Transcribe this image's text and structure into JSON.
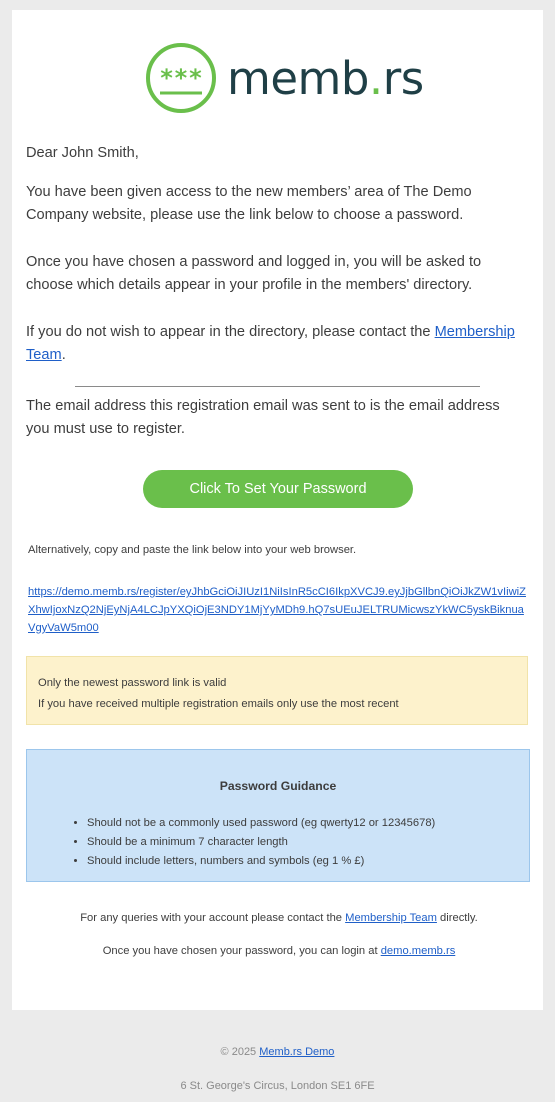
{
  "logo": {
    "brand_prefix": "memb",
    "brand_dot": ".",
    "brand_suffix": "rs",
    "mark_icon": "asterisk-badge-icon",
    "accent_color": "#6abf4b",
    "text_color": "#1f3f46"
  },
  "email": {
    "greeting": "Dear John Smith,",
    "para1": "You have been given access to the new members’ area of The Demo Company website, please use the link below to choose a password.",
    "para2": "Once you have chosen a password and logged in, you will be asked to choose which details appear in your profile in the members' directory.",
    "para3_prefix": "If you do not wish to appear in the directory, please contact the ",
    "para3_link": "Membership Team",
    "para3_suffix": ".",
    "registration_note": "The email address this registration email was sent to is the email address you must use to register.",
    "cta_label": "Click To Set Your Password",
    "alt_text": "Alternatively, copy and paste the link below into your web browser.",
    "register_link": "https://demo.memb.rs/register/eyJhbGciOiJIUzI1NiIsInR5cCI6IkpXVCJ9.eyJjbGllbnQiOiJkZW1vIiwiZXhwIjoxNzQ2NjEyNjA4LCJpYXQiOjE3NDY1MjYyMDh9.hQ7sUEuJELTRUMicwszYkWC5yskBiknuaVgyVaW5m00"
  },
  "notice": {
    "line1": "Only the newest password link is valid",
    "line2": "If you have received multiple registration emails only use the most recent"
  },
  "guidance": {
    "title": "Password Guidance",
    "items": [
      "Should not be a commonly used password (eg qwerty12 or 12345678)",
      "Should be a minimum 7 character length",
      "Should include letters, numbers and symbols (eg 1 % £)"
    ]
  },
  "queries": {
    "prefix": "For any queries with your account please contact the ",
    "link": "Membership Team",
    "suffix": " directly."
  },
  "login": {
    "prefix": "Once you have chosen your password, you can login at ",
    "link": "demo.memb.rs"
  },
  "footer": {
    "copyright_prefix": "© 2025 ",
    "copyright_link": "Memb.rs Demo",
    "address": "6 St. George's Circus, London SE1 6FE"
  }
}
